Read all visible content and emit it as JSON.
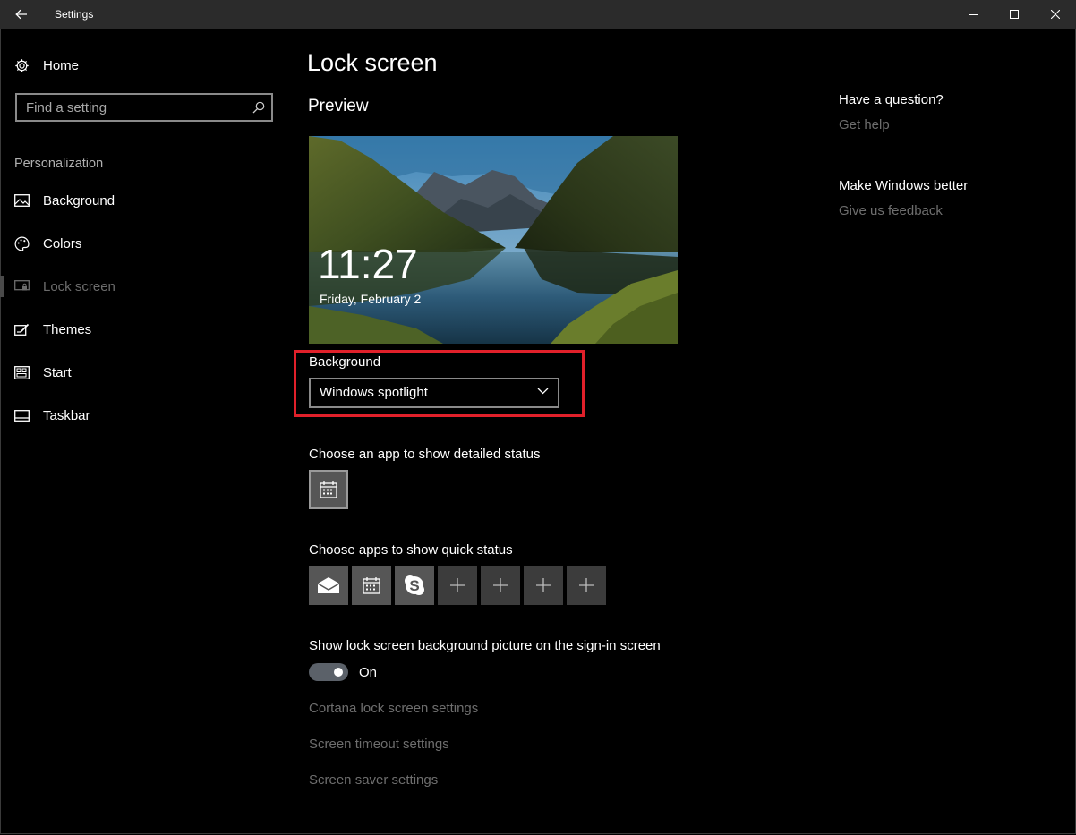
{
  "window": {
    "title": "Settings"
  },
  "sidebar": {
    "home_label": "Home",
    "search_placeholder": "Find a setting",
    "section_label": "Personalization",
    "items": [
      {
        "label": "Background",
        "icon": "picture-icon"
      },
      {
        "label": "Colors",
        "icon": "palette-icon"
      },
      {
        "label": "Lock screen",
        "icon": "lock-screen-icon",
        "active": true
      },
      {
        "label": "Themes",
        "icon": "themes-icon"
      },
      {
        "label": "Start",
        "icon": "start-icon"
      },
      {
        "label": "Taskbar",
        "icon": "taskbar-icon"
      }
    ]
  },
  "main": {
    "title": "Lock screen",
    "preview_heading": "Preview",
    "preview": {
      "time": "11:27",
      "date": "Friday, February 2"
    },
    "background_label": "Background",
    "background_value": "Windows spotlight",
    "detailed_status_label": "Choose an app to show detailed status",
    "quick_status_label": "Choose apps to show quick status",
    "quick_status_apps": [
      "mail-icon",
      "calendar-icon",
      "skype-icon",
      "add-icon",
      "add-icon",
      "add-icon",
      "add-icon"
    ],
    "signin_label": "Show lock screen background picture on the sign-in screen",
    "toggle_state": "On",
    "links": [
      "Cortana lock screen settings",
      "Screen timeout settings",
      "Screen saver settings"
    ]
  },
  "help": {
    "question": "Have a question?",
    "get_help": "Get help",
    "make_better": "Make Windows better",
    "feedback": "Give us feedback"
  },
  "colors": {
    "highlight": "#e0202a",
    "link": "#6e6e6e",
    "titlebar": "#2b2b2b"
  }
}
